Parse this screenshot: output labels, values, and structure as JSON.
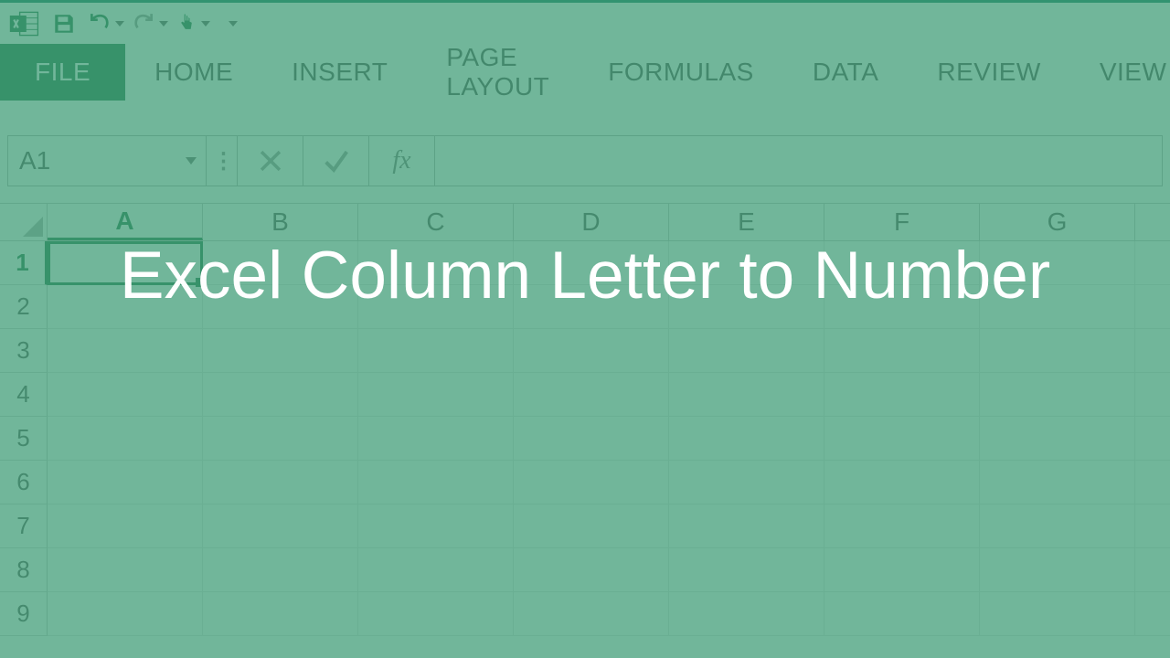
{
  "overlay_title": "Excel Column Letter to Number",
  "ribbon": {
    "tabs": [
      "FILE",
      "HOME",
      "INSERT",
      "PAGE LAYOUT",
      "FORMULAS",
      "DATA",
      "REVIEW",
      "VIEW"
    ],
    "active_tab": "FILE"
  },
  "name_box": {
    "value": "A1"
  },
  "formula_bar": {
    "fx_label": "fx",
    "value": ""
  },
  "grid": {
    "columns": [
      "A",
      "B",
      "C",
      "D",
      "E",
      "F",
      "G"
    ],
    "rows": [
      "1",
      "2",
      "3",
      "4",
      "5",
      "6",
      "7",
      "8",
      "9"
    ],
    "active_column": "A",
    "active_row": "1",
    "active_cell": "A1"
  },
  "colors": {
    "excel_green": "#217346",
    "overlay_green": "rgba(64,156,119,0.74)"
  }
}
